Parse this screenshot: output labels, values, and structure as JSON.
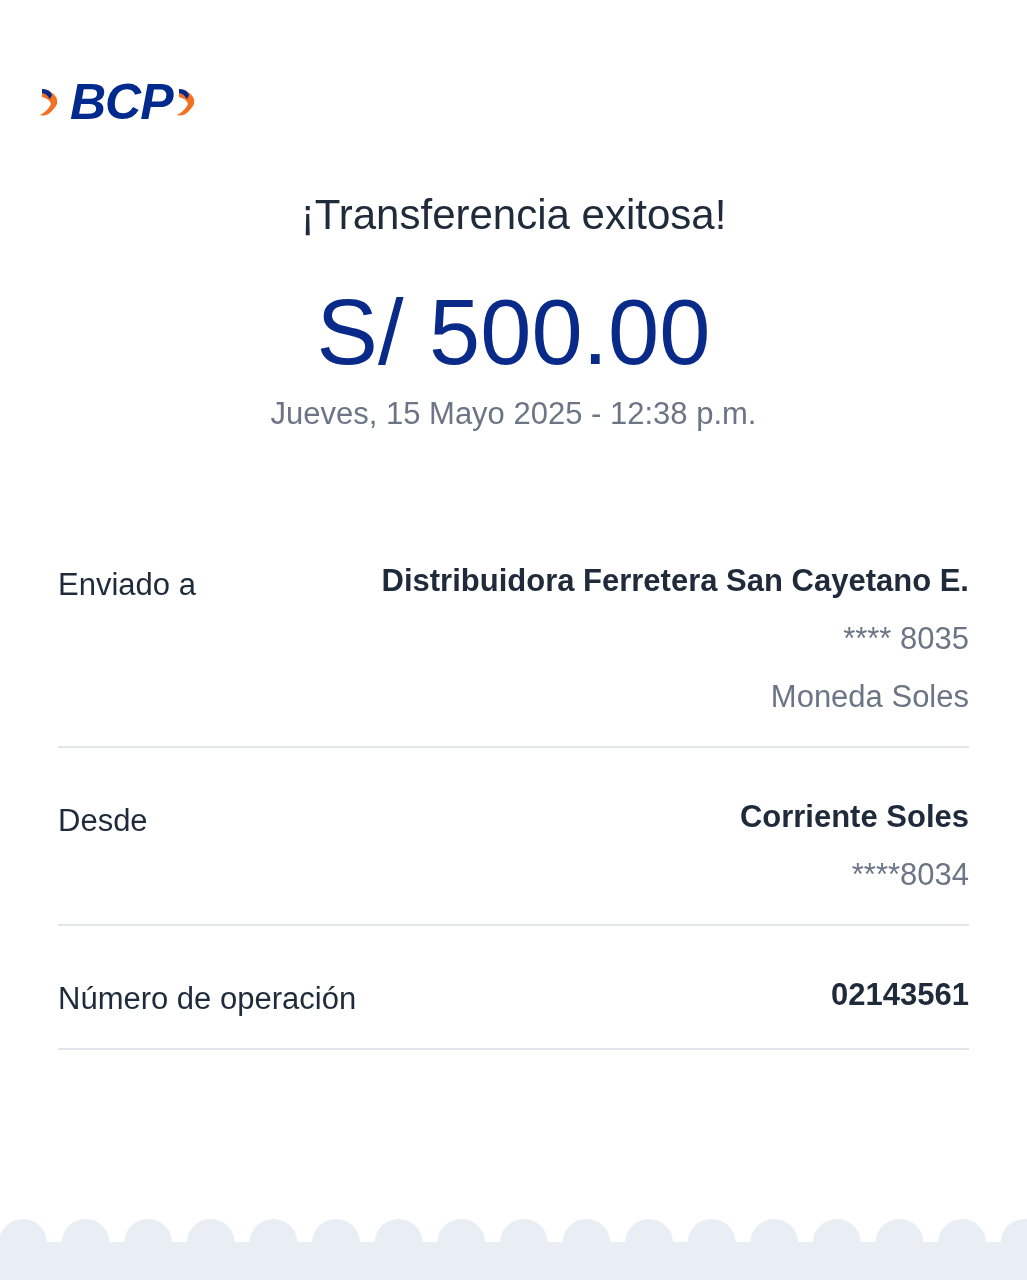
{
  "logo": {
    "text": "BCP"
  },
  "title": "¡Transferencia exitosa!",
  "amount": "S/ 500.00",
  "datetime": "Jueves, 15 Mayo 2025 - 12:38 p.m.",
  "details": [
    {
      "label": "Enviado a",
      "values": [
        {
          "kind": "primary",
          "text": "Distribuidora Ferretera San Cayetano E."
        },
        {
          "kind": "secondary",
          "text": "**** 8035"
        },
        {
          "kind": "secondary",
          "text": "Moneda Soles"
        }
      ]
    },
    {
      "label": "Desde",
      "values": [
        {
          "kind": "primary",
          "text": "Corriente Soles"
        },
        {
          "kind": "secondary",
          "text": "****8034"
        }
      ]
    },
    {
      "label": "Número de operación",
      "values": [
        {
          "kind": "primary",
          "text": "02143561"
        }
      ]
    }
  ]
}
